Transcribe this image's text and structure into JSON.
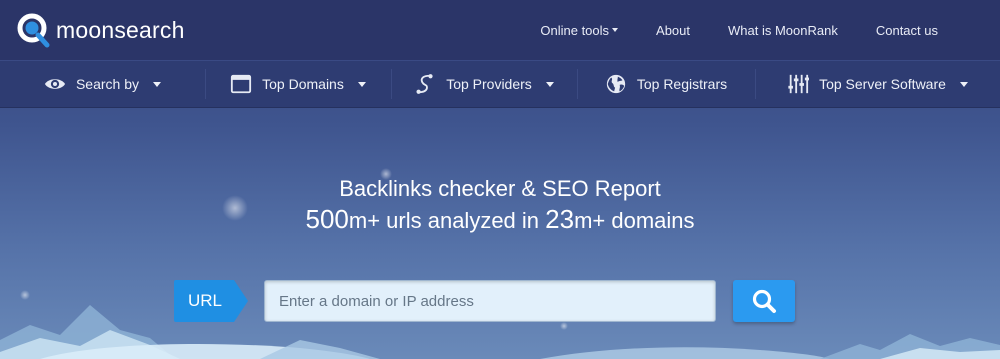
{
  "brand": {
    "name": "moonsearch"
  },
  "topnav": {
    "online_tools": "Online tools",
    "about": "About",
    "what_is": "What is MoonRank",
    "contact": "Contact us"
  },
  "mainnav": {
    "items": [
      {
        "label": "Search by",
        "icon": "eye-icon",
        "dropdown": true
      },
      {
        "label": "Top Domains",
        "icon": "window-icon",
        "dropdown": true
      },
      {
        "label": "Top Providers",
        "icon": "connection-icon",
        "dropdown": true
      },
      {
        "label": "Top Registrars",
        "icon": "globe-icon",
        "dropdown": false
      },
      {
        "label": "Top Server Software",
        "icon": "sliders-icon",
        "dropdown": true
      }
    ]
  },
  "hero": {
    "line1": "Backlinks checker & SEO Report",
    "urls_count": "500",
    "urls_suffix": "m+ urls analyzed in ",
    "domains_count": "23",
    "domains_suffix": "m+ domains"
  },
  "search": {
    "tag": "URL",
    "placeholder": "Enter a domain or IP address",
    "value": ""
  },
  "colors": {
    "topbar": "#2b3568",
    "mainnav": "#2e3c72",
    "accent": "#2b9af0",
    "url_tag": "#1f8fe3"
  }
}
